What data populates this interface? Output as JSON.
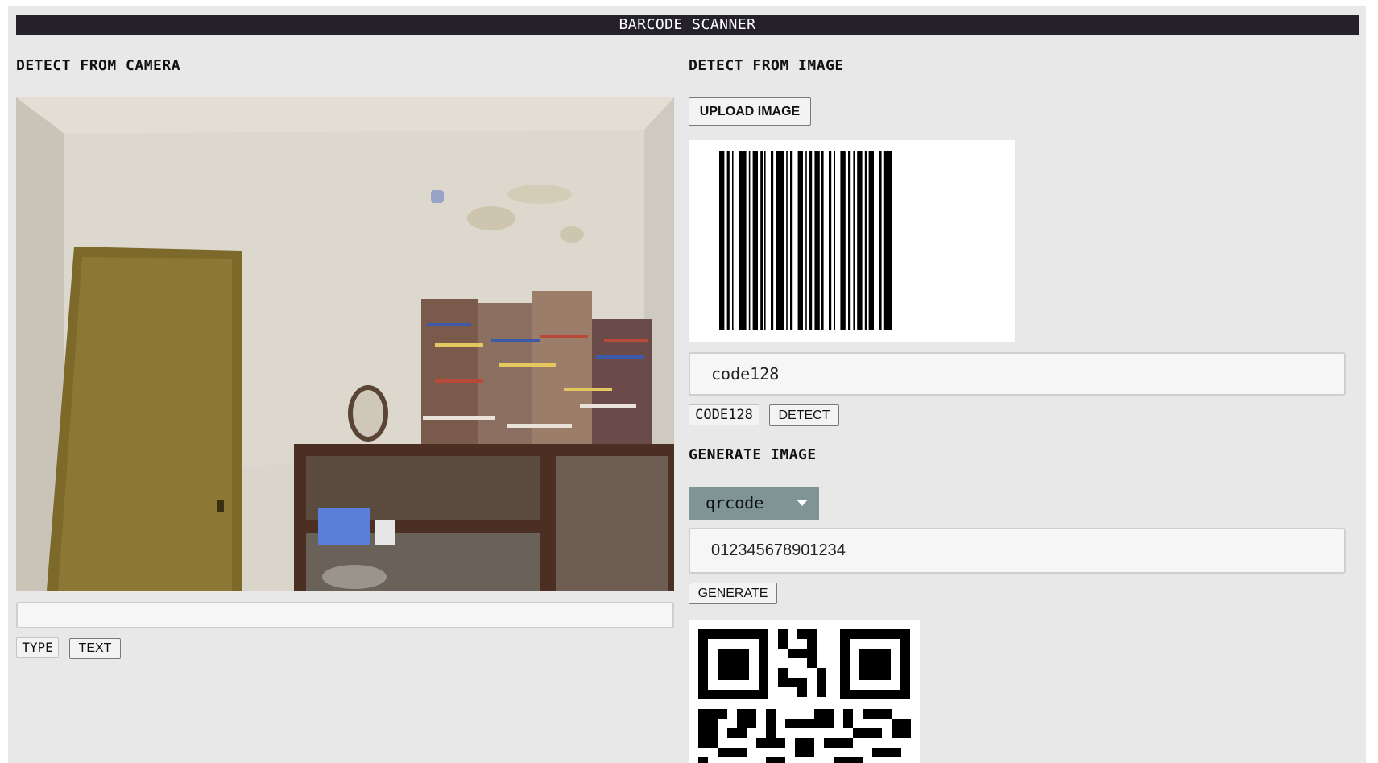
{
  "header": {
    "title": "BARCODE SCANNER"
  },
  "camera_section": {
    "title": "DETECT FROM CAMERA",
    "result_value": "",
    "type_label": "TYPE",
    "text_button": "TEXT"
  },
  "image_section": {
    "title": "DETECT FROM IMAGE",
    "upload_button": "UPLOAD IMAGE",
    "detected_value": "code128",
    "type_tag": "CODE128",
    "detect_button": "DETECT"
  },
  "generate_section": {
    "title": "GENERATE IMAGE",
    "format_selected": "qrcode",
    "input_value": "012345678901234",
    "generate_button": "GENERATE"
  },
  "colors": {
    "titlebar": "#25212b",
    "page_bg": "#e8e8e8",
    "select_bg": "#7f9494"
  },
  "icons": {
    "dropdown": "chevron-down-icon"
  }
}
